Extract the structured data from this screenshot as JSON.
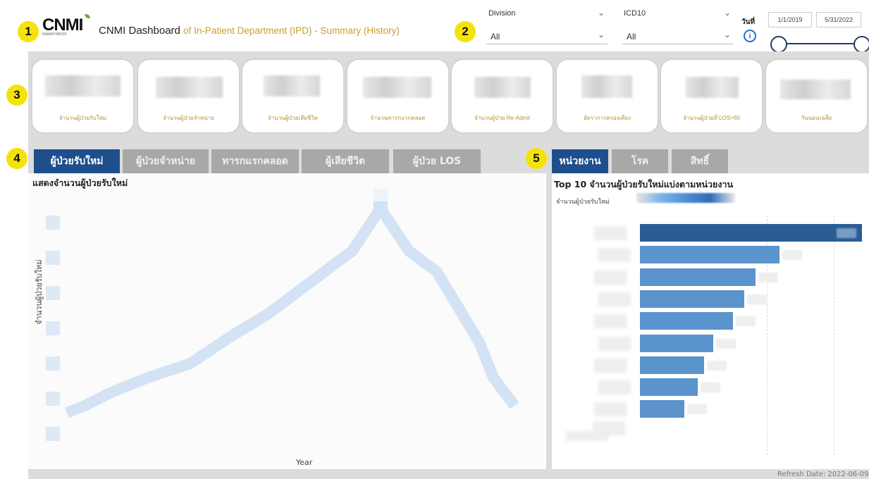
{
  "header": {
    "logo_text": "CNMI",
    "logo_subtext": "RAMATHIBODI",
    "title_main": "CNMI Dashboard",
    "title_sub": "of In-Patient Department (IPD) - Summary (History)"
  },
  "badges": [
    "1",
    "2",
    "3",
    "4",
    "5"
  ],
  "filters": {
    "division": {
      "label": "Division",
      "value": "All"
    },
    "icd10": {
      "label": "ICD10",
      "value": "All"
    },
    "date_label": "วันที่",
    "date_start": "1/1/2019",
    "date_end": "5/31/2022"
  },
  "kpi_cards": [
    {
      "label": "จำนวนผู้ป่วยรับใหม่"
    },
    {
      "label": "จำนวนผู้ป่วยจำหน่าย"
    },
    {
      "label": "จำนวนผู้ป่วยเสียชีวิต"
    },
    {
      "label": "จำนวนทารกแรกคลอด"
    },
    {
      "label": "จำนวนผู้ป่วย Re-Admit"
    },
    {
      "label": "อัตราการครองเตียง"
    },
    {
      "label": "จำนวนผู้ป่วยที่ LOS>60"
    },
    {
      "label": "วันนอนเฉลี่ย"
    }
  ],
  "left_tabs": [
    {
      "label": "ผู้ป่วยรับใหม่",
      "active": true
    },
    {
      "label": "ผู้ป่วยจำหน่าย",
      "active": false
    },
    {
      "label": "ทารกแรกคลอด",
      "active": false
    },
    {
      "label": "ผู้เสียชีวิต",
      "active": false
    },
    {
      "label": "ผู้ป่วย LOS",
      "active": false
    }
  ],
  "right_tabs": [
    {
      "label": "หน่วยงาน",
      "active": true
    },
    {
      "label": "โรค",
      "active": false
    },
    {
      "label": "สิทธิ์",
      "active": false
    }
  ],
  "left_panel": {
    "title": "แสดงจำนวนผู้ป่วยรับใหม่",
    "y_axis_label": "จำนวนผู้ป่วยรับใหม่",
    "x_axis_label": "Year"
  },
  "right_panel": {
    "title": "Top 10 จำนวนผู้ป่วยรับใหม่แบ่งตามหน่วยงาน",
    "legend_label": "จำนวนผู้ป่วยรับใหม่",
    "bar_fractions": [
      1.0,
      0.63,
      0.52,
      0.47,
      0.42,
      0.33,
      0.29,
      0.26,
      0.2
    ],
    "bar_color": "#5b93cc",
    "top_bar_color": "#2a5d96"
  },
  "footer": {
    "refresh": "Refresh Date: 2022-06-09"
  },
  "colors": {
    "accent": "#1f4e8c",
    "badge": "#f5e20b",
    "gold_text": "#c9a12a"
  }
}
